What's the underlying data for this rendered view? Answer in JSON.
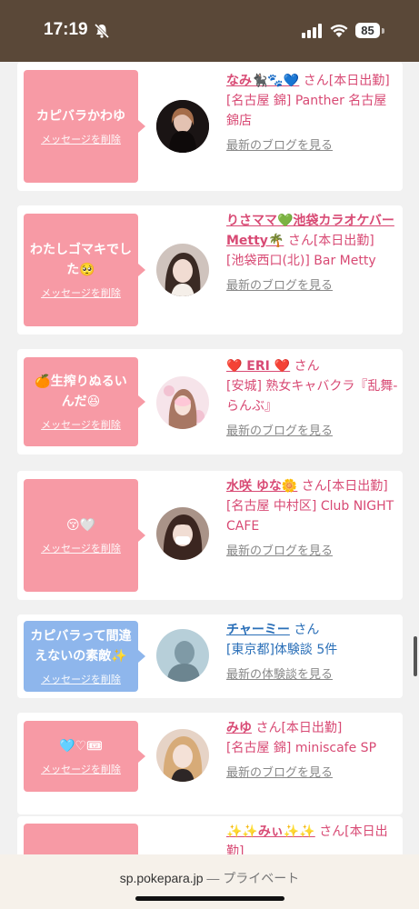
{
  "status": {
    "time": "17:19",
    "battery": "85"
  },
  "cards": [
    {
      "message": "カピバラかわゆ",
      "delete": "メッセージを削除",
      "name": "なみ🐈‍⬛🐾💙",
      "san": "さん[本日出勤]",
      "shop": "[名古屋 錦] Panther 名古屋錦店",
      "link": "最新のブログを見る"
    },
    {
      "message": "わたしゴマキでした🥺",
      "delete": "メッセージを削除",
      "name": "りさママ💚池袋カラオケバーMetty🌴",
      "san": "さん[本日出勤]",
      "shop": "[池袋西口(北)] Bar Metty",
      "link": "最新のブログを見る"
    },
    {
      "message": "🍊生搾りぬるいんだ😆",
      "delete": "メッセージを削除",
      "name": "❤️ ERI ❤️",
      "san": "さん",
      "shop": "[安城] 熟女キャバクラ『乱舞-らんぶ』",
      "link": "最新のブログを見る"
    },
    {
      "message": "😚🤍",
      "delete": "メッセージを削除",
      "name": "水咲 ゆな🌼",
      "san": "さん[本日出勤]",
      "shop": "[名古屋 中村区] Club NIGHT CAFE",
      "link": "最新のブログを見る"
    },
    {
      "message": "カピバラって間違えないの素敵✨",
      "delete": "メッセージを削除",
      "name": "チャーミー",
      "san": "さん",
      "shop": "[東京都]体験談 5件",
      "link": "最新の体験談を見る"
    },
    {
      "message": "🩵♡🎟",
      "delete": "メッセージを削除",
      "name": "みゆ",
      "san": "さん[本日出勤]",
      "shop": "[名古屋 錦] miniscafe SP",
      "link": "最新のブログを見る"
    },
    {
      "name": "✨✨みぃ✨✨",
      "san": "さん[本日出勤]"
    }
  ],
  "browser": {
    "url": "sp.pokepara.jp",
    "separator": "—",
    "mode": "プライベート"
  },
  "colors": {
    "status_bg": "#5a4838",
    "bubble_pink": "#f79aa5",
    "bubble_blue": "#8eb6ec",
    "name_pink": "#d84a74",
    "name_blue": "#2a6fb8"
  }
}
